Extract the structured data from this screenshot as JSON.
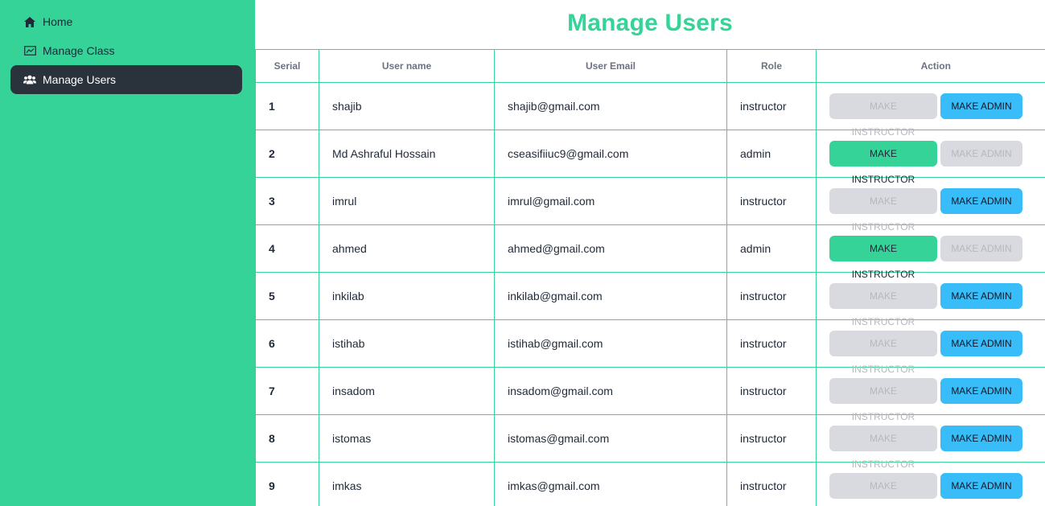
{
  "sidebar": {
    "items": [
      {
        "label": "Home",
        "icon": "home-icon",
        "active": false
      },
      {
        "label": "Manage Class",
        "icon": "chart-icon",
        "active": false
      },
      {
        "label": "Manage Users",
        "icon": "users-icon",
        "active": true
      }
    ]
  },
  "main": {
    "title": "Manage Users",
    "table": {
      "headers": {
        "serial": "Serial",
        "username": "User name",
        "email": "User Email",
        "role": "Role",
        "action": "Action"
      },
      "make_instructor_label": "Make Instructor",
      "make_admin_label": "Make Admin",
      "rows": [
        {
          "serial": "1",
          "name": "shajib",
          "email": "shajib@gmail.com",
          "role": "instructor"
        },
        {
          "serial": "2",
          "name": "Md Ashraful Hossain",
          "email": "cseasifiiuc9@gmail.com",
          "role": "admin"
        },
        {
          "serial": "3",
          "name": "imrul",
          "email": "imrul@gmail.com",
          "role": "instructor"
        },
        {
          "serial": "4",
          "name": "ahmed",
          "email": "ahmed@gmail.com",
          "role": "admin"
        },
        {
          "serial": "5",
          "name": "inkilab",
          "email": "inkilab@gmail.com",
          "role": "instructor"
        },
        {
          "serial": "6",
          "name": "istihab",
          "email": "istihab@gmail.com",
          "role": "instructor"
        },
        {
          "serial": "7",
          "name": "insadom",
          "email": "insadom@gmail.com",
          "role": "instructor"
        },
        {
          "serial": "8",
          "name": "istomas",
          "email": "istomas@gmail.com",
          "role": "instructor"
        },
        {
          "serial": "9",
          "name": "imkas",
          "email": "imkas@gmail.com",
          "role": "instructor"
        }
      ]
    }
  },
  "colors": {
    "accent": "#36d399",
    "sidebar_active_bg": "#2a323c",
    "admin_button": "#38bdf8",
    "disabled_button": "#d9dadf"
  }
}
